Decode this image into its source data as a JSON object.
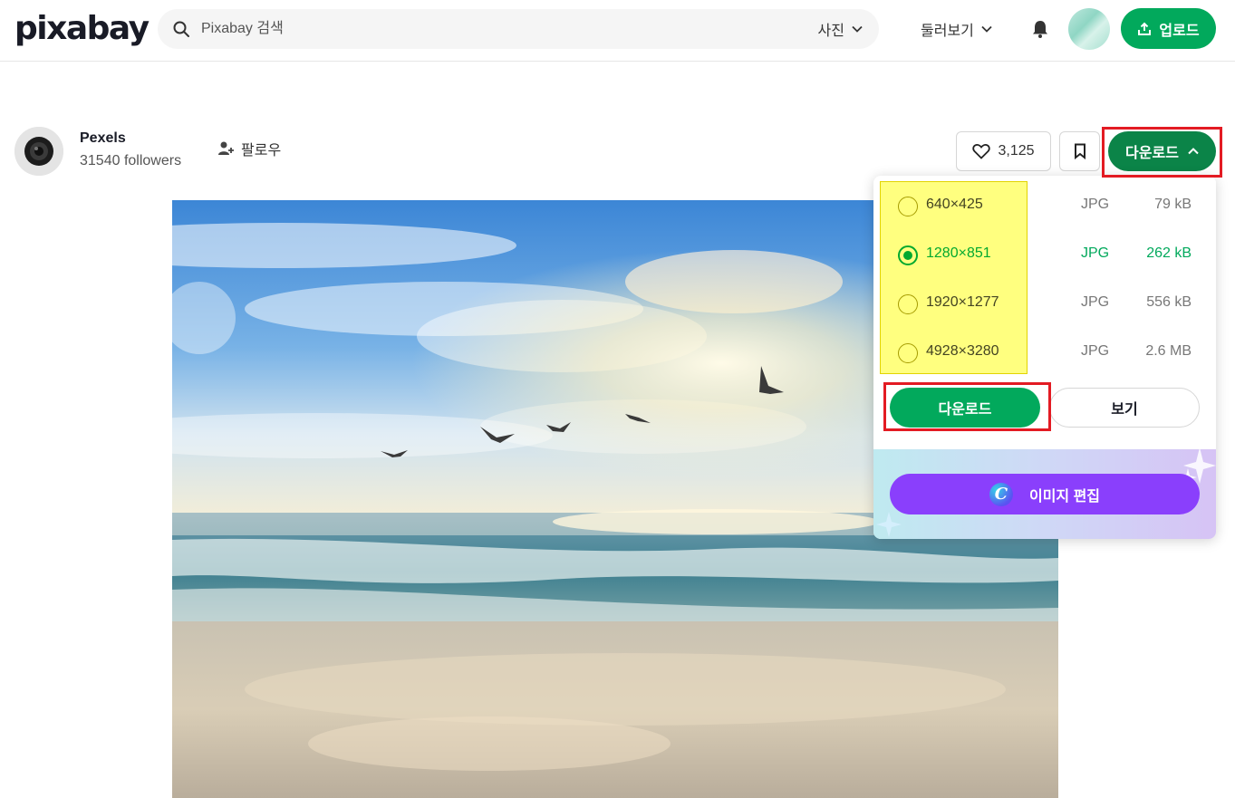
{
  "header": {
    "logo": "pixabay",
    "search_placeholder": "Pixabay 검색",
    "search_type": "사진",
    "explore_label": "둘러보기",
    "upload_label": "업로드"
  },
  "author": {
    "name": "Pexels",
    "followers": "31540 followers",
    "follow_label": "팔로우"
  },
  "actions": {
    "like_count": "3,125",
    "download_label": "다운로드"
  },
  "download_menu": {
    "options": [
      {
        "dimensions": "640×425",
        "format": "JPG",
        "size": "79 kB",
        "selected": false
      },
      {
        "dimensions": "1280×851",
        "format": "JPG",
        "size": "262 kB",
        "selected": true
      },
      {
        "dimensions": "1920×1277",
        "format": "JPG",
        "size": "556 kB",
        "selected": false
      },
      {
        "dimensions": "4928×3280",
        "format": "JPG",
        "size": "2.6 MB",
        "selected": false
      }
    ],
    "download_button": "다운로드",
    "view_button": "보기",
    "edit_button": "이미지 편집",
    "edit_logo_letter": "C"
  },
  "colors": {
    "brand_green": "#02a95c",
    "dark_green": "#0b8448",
    "canva_purple": "#8a3ffc",
    "highlight_red": "#e31b23",
    "highlight_yellow": "#ffff00"
  }
}
